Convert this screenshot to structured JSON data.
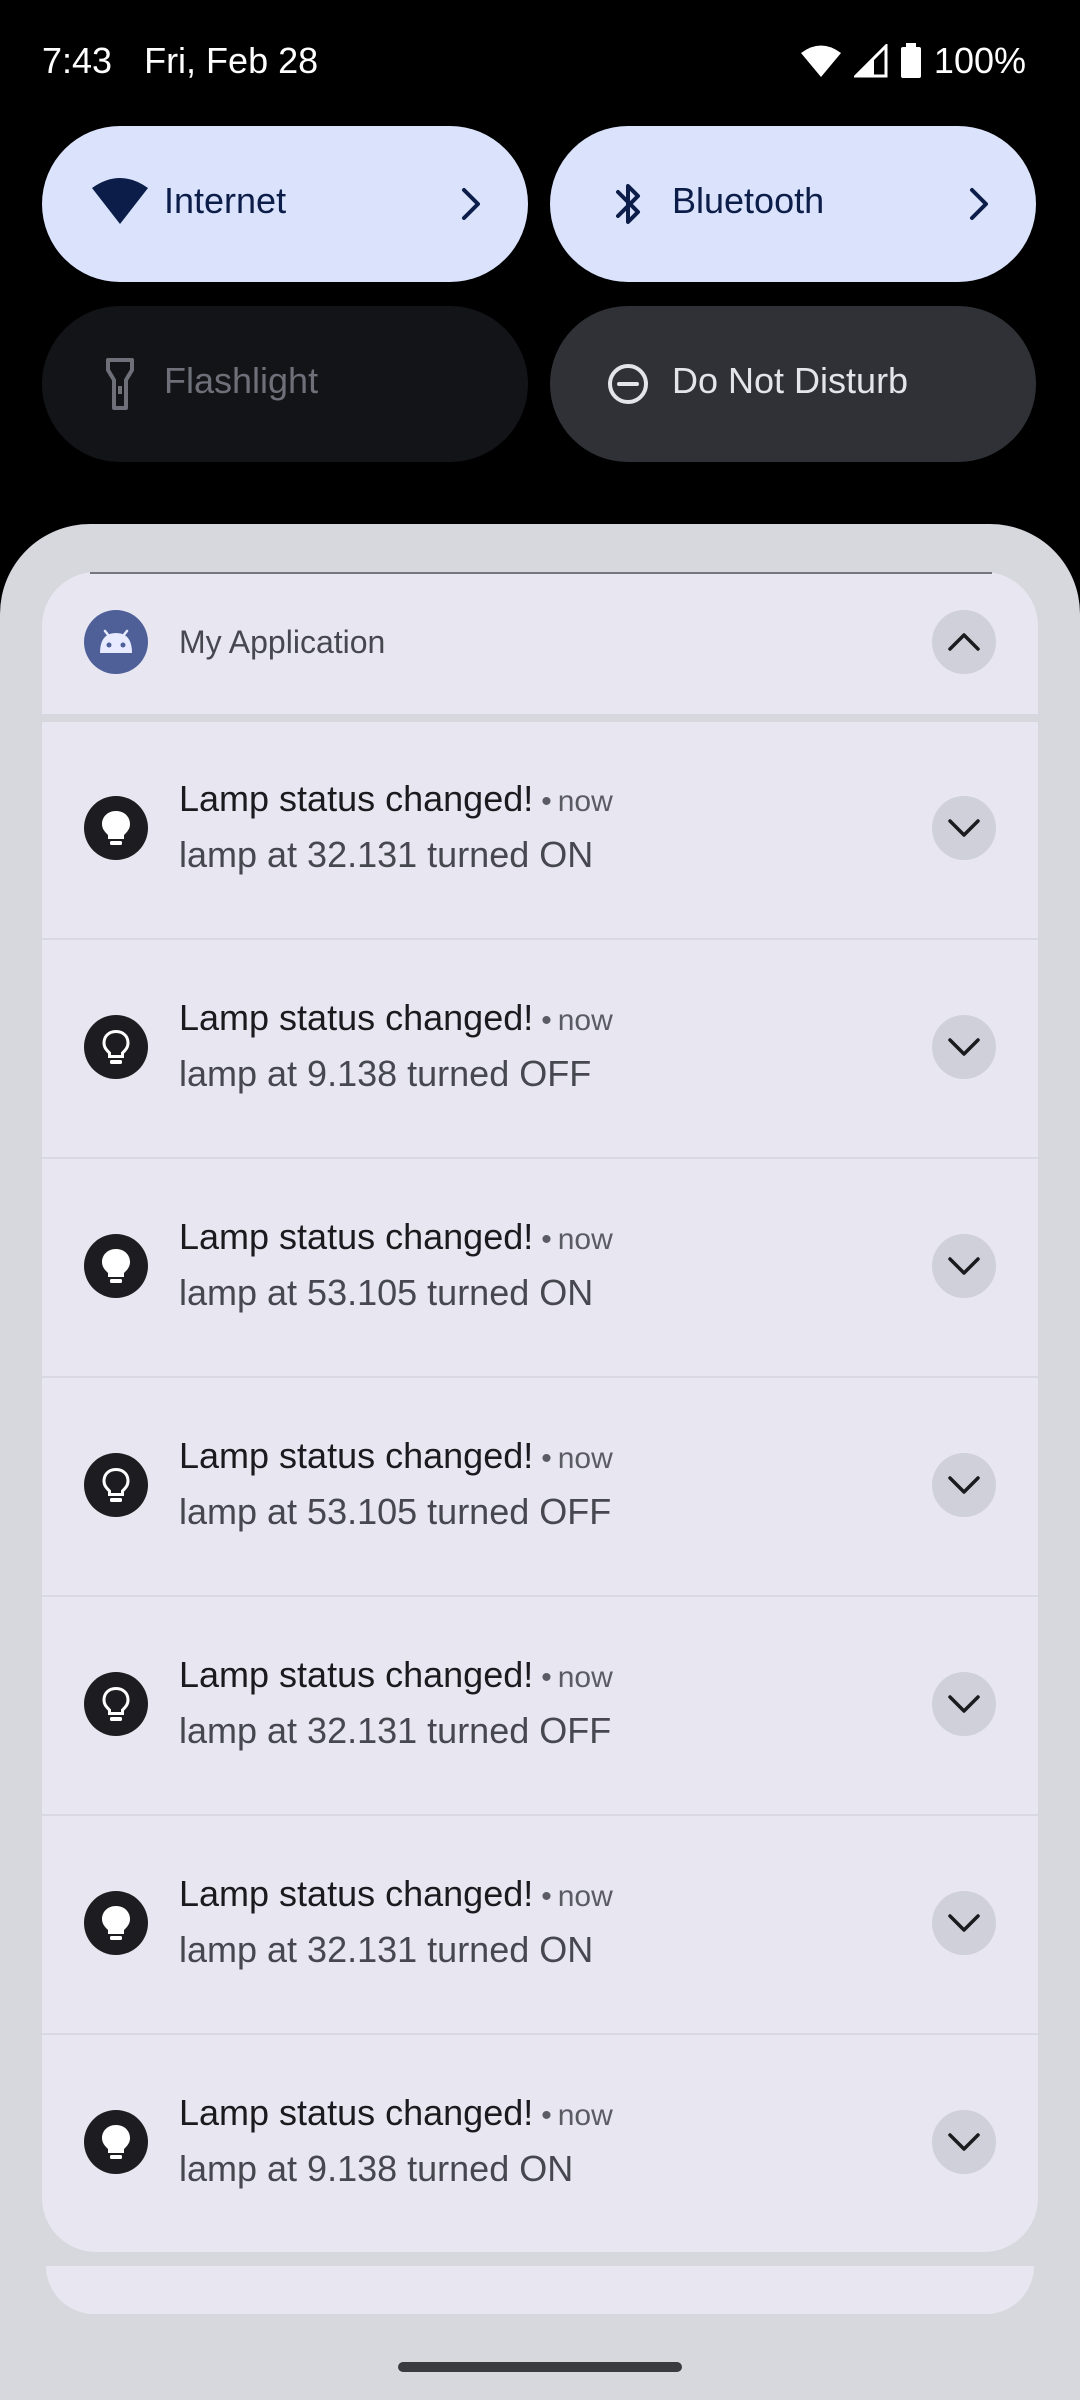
{
  "status_bar": {
    "time": "7:43",
    "date": "Fri, Feb 28",
    "battery": "100%"
  },
  "quick_settings": {
    "internet": {
      "label": "Internet",
      "state": "on"
    },
    "bluetooth": {
      "label": "Bluetooth",
      "state": "on"
    },
    "flashlight": {
      "label": "Flashlight",
      "state": "unavailable"
    },
    "dnd": {
      "label": "Do Not Disturb",
      "state": "off"
    }
  },
  "notification_group": {
    "app_name": "My Application",
    "notifications": [
      {
        "title": "Lamp status changed!",
        "time": "now",
        "text": "lamp at 32.131 turned ON",
        "icon": "lightbulb-filled-icon"
      },
      {
        "title": "Lamp status changed!",
        "time": "now",
        "text": "lamp at 9.138 turned OFF",
        "icon": "lightbulb-outline-icon"
      },
      {
        "title": "Lamp status changed!",
        "time": "now",
        "text": "lamp at 53.105 turned ON",
        "icon": "lightbulb-filled-icon"
      },
      {
        "title": "Lamp status changed!",
        "time": "now",
        "text": "lamp at 53.105 turned OFF",
        "icon": "lightbulb-outline-icon"
      },
      {
        "title": "Lamp status changed!",
        "time": "now",
        "text": "lamp at 32.131 turned OFF",
        "icon": "lightbulb-outline-icon"
      },
      {
        "title": "Lamp status changed!",
        "time": "now",
        "text": "lamp at 32.131 turned ON",
        "icon": "lightbulb-filled-icon"
      },
      {
        "title": "Lamp status changed!",
        "time": "now",
        "text": "lamp at 9.138 turned ON",
        "icon": "lightbulb-filled-icon"
      }
    ]
  },
  "colors": {
    "tile_active": "#dae3fb",
    "tile_inactive": "#2f3136",
    "shade": "#d7d7de",
    "card": "#e8e7f1",
    "app_icon": "#4f5f98"
  }
}
